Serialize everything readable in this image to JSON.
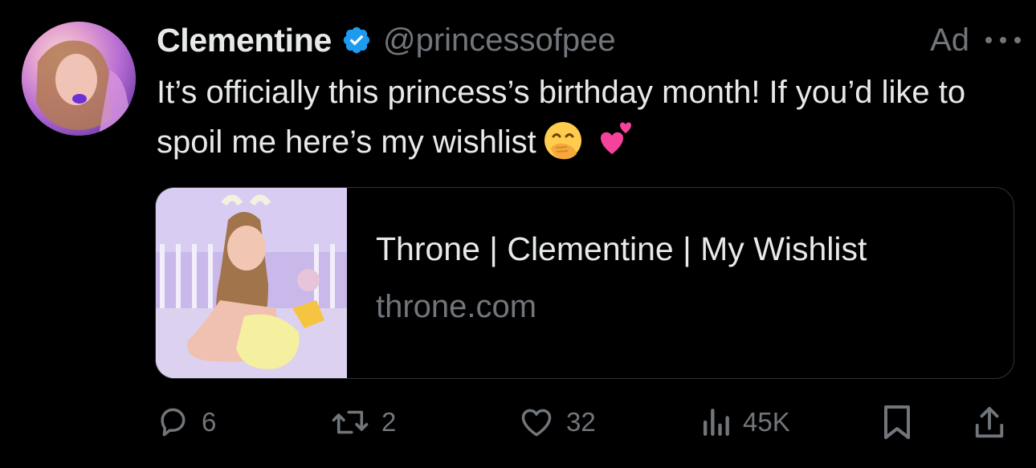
{
  "tweet": {
    "display_name": "Clementine",
    "handle": "@princessofpee",
    "ad_label": "Ad",
    "text": "It’s officially this princess’s birthday month! If you’d like to spoil me here’s my wishlist",
    "emojis": [
      "face-with-hand-over-mouth",
      "two-hearts"
    ]
  },
  "card": {
    "title": "Throne | Clementine | My Wishlist",
    "domain": "throne.com"
  },
  "actions": {
    "replies": "6",
    "retweets": "2",
    "likes": "32",
    "views": "45K"
  },
  "icons": {
    "verified": "verified-badge-icon",
    "more": "more-options-icon",
    "reply": "reply-icon",
    "retweet": "retweet-icon",
    "like": "heart-icon",
    "views": "views-icon",
    "bookmark": "bookmark-icon",
    "share": "share-icon"
  },
  "colors": {
    "background": "#000000",
    "text": "#e7e9ea",
    "secondary": "#71767b",
    "verified": "#1d9bf0",
    "border": "#2f3336"
  }
}
